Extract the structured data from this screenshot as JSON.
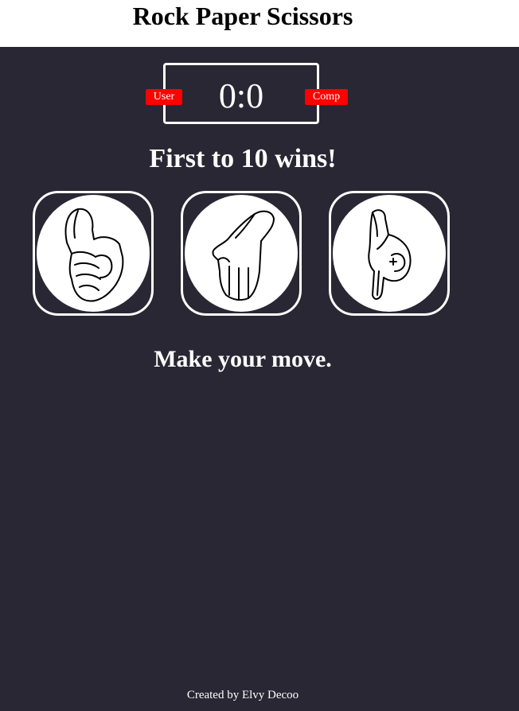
{
  "header": {
    "title": "Rock Paper Scissors"
  },
  "scoreboard": {
    "score": "0:0",
    "user_badge": "User",
    "comp_badge": "Comp"
  },
  "messages": {
    "goal": "First to 10 wins!",
    "prompt": "Make your move."
  },
  "choices": [
    {
      "name": "rock",
      "icon": "rock-hand-icon"
    },
    {
      "name": "paper",
      "icon": "paper-hand-icon"
    },
    {
      "name": "scissors",
      "icon": "scissors-hand-icon"
    }
  ],
  "footer": {
    "credit": "Created by Elvy Decoo"
  },
  "colors": {
    "background": "#282733",
    "header": "#ffffff",
    "badge": "#ff0000",
    "text": "#ffffff"
  }
}
